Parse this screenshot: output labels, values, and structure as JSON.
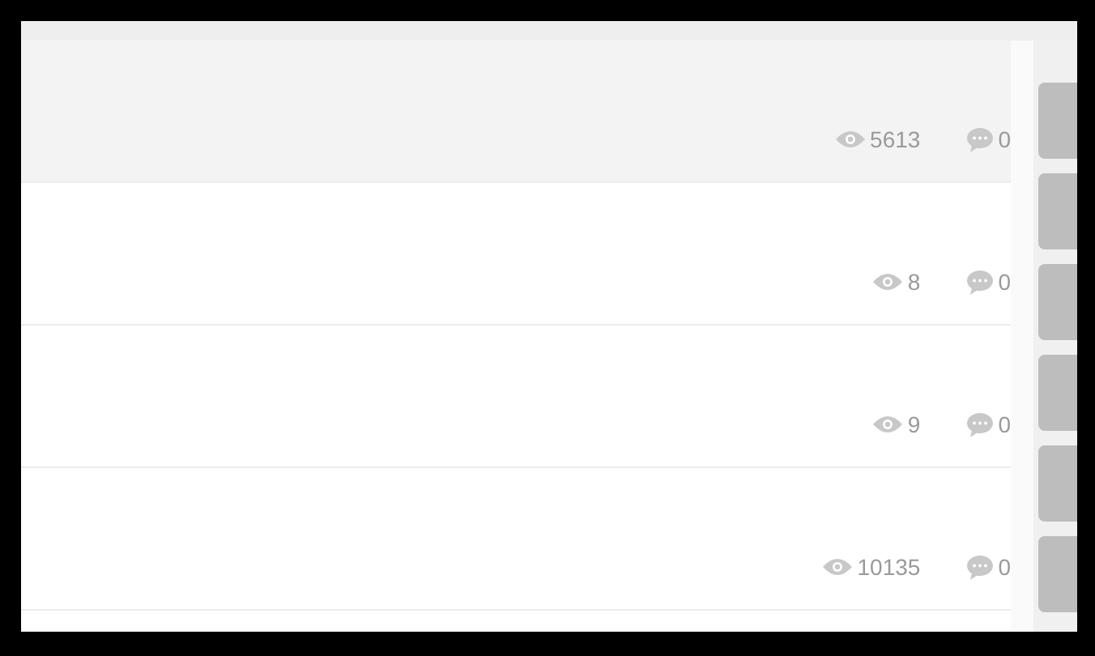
{
  "threads": [
    {
      "views": "5613",
      "replies": "0",
      "selected": true
    },
    {
      "views": "8",
      "replies": "0",
      "selected": false
    },
    {
      "views": "9",
      "replies": "0",
      "selected": false
    },
    {
      "views": "10135",
      "replies": "0",
      "selected": false
    }
  ]
}
